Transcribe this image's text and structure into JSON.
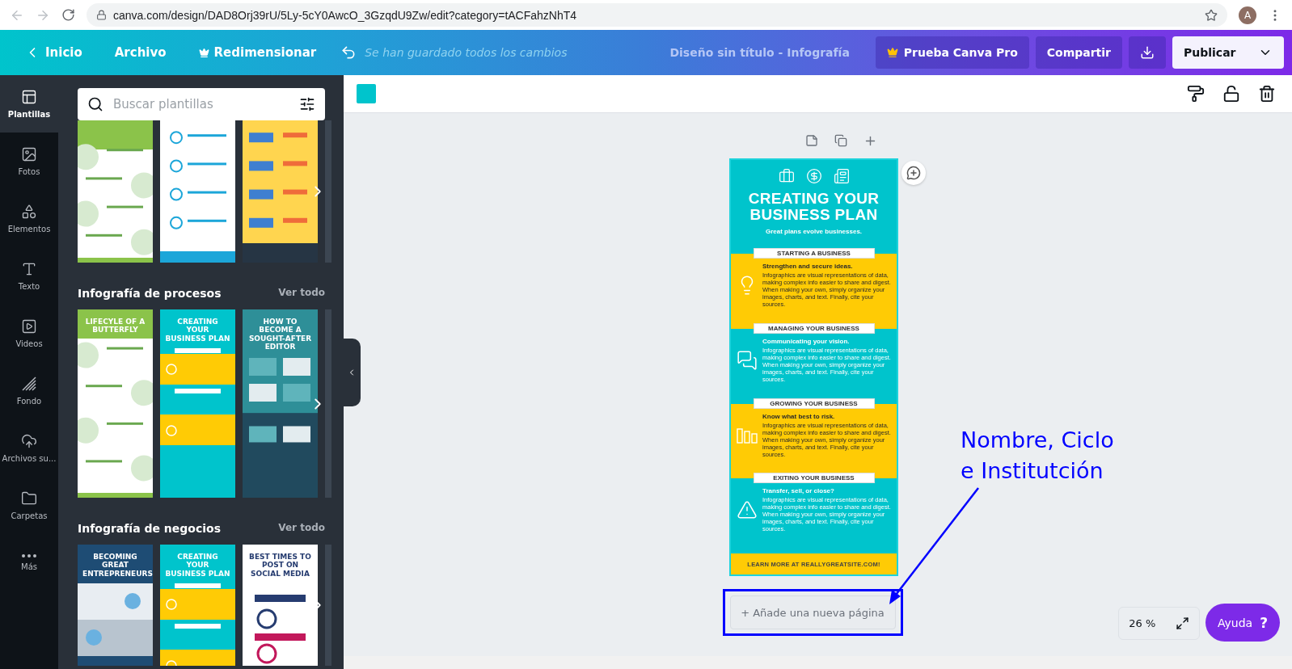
{
  "browser": {
    "url": "canva.com/design/DAD8Orj39rU/5Ly-5cY0AwcO_3GzqdU9Zw/edit?category=tACFahzNhT4",
    "avatar": "A"
  },
  "toolbar": {
    "home": "Inicio",
    "file": "Archivo",
    "resize": "Redimensionar",
    "status": "Se han guardado todos los cambios",
    "title": "Diseño sin título - Infografía",
    "pro": "Prueba Canva Pro",
    "share": "Compartir",
    "publish": "Publicar"
  },
  "rail": [
    {
      "kind": "templates",
      "label": "Plantillas",
      "selected": true
    },
    {
      "kind": "photos",
      "label": "Fotos",
      "selected": false
    },
    {
      "kind": "elements",
      "label": "Elementos",
      "selected": false
    },
    {
      "kind": "text",
      "label": "Texto",
      "selected": false
    },
    {
      "kind": "videos",
      "label": "Videos",
      "selected": false
    },
    {
      "kind": "background",
      "label": "Fondo",
      "selected": false
    },
    {
      "kind": "uploads",
      "label": "Archivos su...",
      "selected": false
    },
    {
      "kind": "folders",
      "label": "Carpetas",
      "selected": false
    },
    {
      "kind": "more",
      "label": "Más",
      "selected": false
    }
  ],
  "search": {
    "placeholder": "Buscar plantillas"
  },
  "template_groups": [
    {
      "thumbnails": [
        {
          "kind": "butterfly"
        },
        {
          "kind": "bluelist"
        },
        {
          "kind": "stats"
        }
      ]
    },
    {
      "title": "Infografía de procesos",
      "see_all": "Ver todo",
      "thumbnails": [
        {
          "kind": "butterfly",
          "title": "LIFECYLE OF A BUTTERFLY"
        },
        {
          "kind": "business",
          "title": "CREATING YOUR BUSINESS PLAN"
        },
        {
          "kind": "editor",
          "title": "HOW TO BECOME A SOUGHT-AFTER EDITOR"
        }
      ]
    },
    {
      "title": "Infografía de negocios",
      "see_all": "Ver todo",
      "thumbnails": [
        {
          "kind": "entrepreneurs",
          "title": "BECOMING GREAT ENTREPRENEURS"
        },
        {
          "kind": "business",
          "title": "CREATING YOUR BUSINESS PLAN"
        },
        {
          "kind": "social",
          "title": "BEST TIMES TO POST ON SOCIAL MEDIA"
        }
      ]
    }
  ],
  "design": {
    "title": "CREATING YOUR BUSINESS PLAN",
    "subtitle": "Great plans evolve businesses.",
    "sections": [
      {
        "label": "STARTING A BUSINESS",
        "color": "#ffcb05",
        "kind": "bulb",
        "heading": "Strengthen and secure ideas.",
        "body": "Infographics are visual representations of data, making complex info easier to share and digest. When making your own, simply organize your images, charts, and text. Finally, cite your sources."
      },
      {
        "label": "MANAGING YOUR BUSINESS",
        "color": "#00c4cc",
        "kind": "chat",
        "heading": "Communicating your vision.",
        "body": "Infographics are visual representations of data, making complex info easier to share and digest. When making your own, simply organize your images, charts, and text. Finally, cite your sources."
      },
      {
        "label": "GROWING YOUR BUSINESS",
        "color": "#ffcb05",
        "kind": "bars",
        "heading": "Know what best to risk.",
        "body": "Infographics are visual representations of data, making complex info easier to share and digest. When making your own, simply organize your images, charts, and text. Finally, cite your sources."
      },
      {
        "label": "EXITING YOUR BUSINESS",
        "color": "#00c4cc",
        "kind": "warning",
        "heading": "Transfer, sell, or close?",
        "body": "Infographics are visual representations of data, making complex info easier to share and digest. When making your own, simply organize your images, charts, and text. Finally, cite your sources."
      }
    ],
    "footer": "LEARN MORE AT REALLYGREATSITE.COM!"
  },
  "add_page": "+ Añade una nueva página",
  "annotation": "Nombre, Ciclo\ne Institutción",
  "zoom": "26 %",
  "help": "Ayuda",
  "help_icon": "?"
}
